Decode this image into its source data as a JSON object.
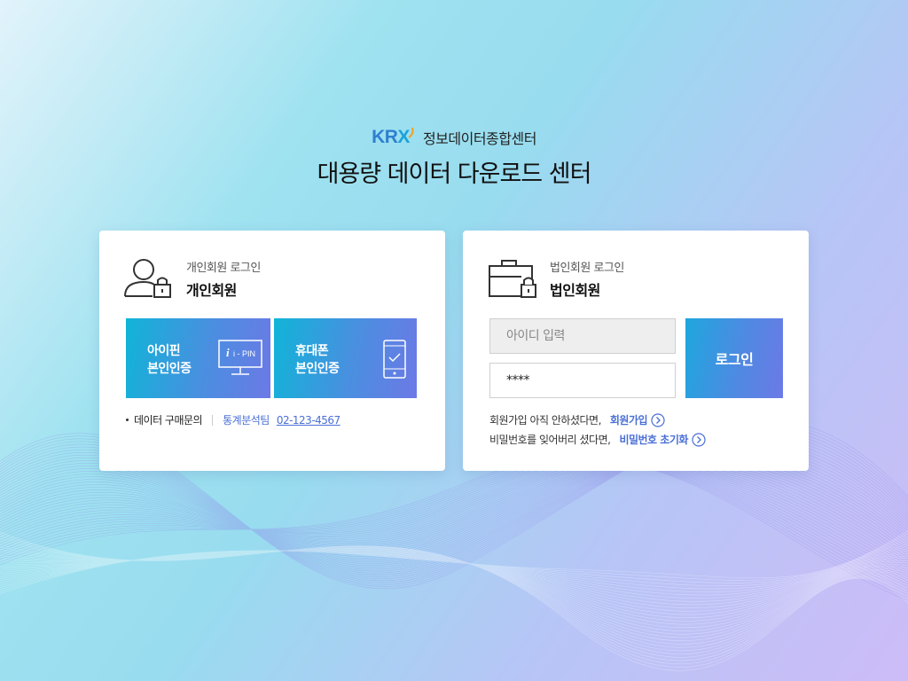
{
  "brand": {
    "logo_text": "KRX",
    "subtitle": "정보데이터종합센터",
    "title": "대용량 데이터 다운로드 센터"
  },
  "personal": {
    "sub": "개인회원 로그인",
    "name": "개인회원",
    "icon": "person-lock-icon",
    "ipin_line1": "아이핀",
    "ipin_line2": "본인인증",
    "ipin_icon": "ipin-monitor-icon",
    "ipin_icon_text": "i - PIN",
    "phone_line1": "휴대폰",
    "phone_line2": "본인인증",
    "phone_icon": "smartphone-check-icon",
    "inquiry_label": "데이터 구매문의",
    "inquiry_team": "통계분석팀",
    "inquiry_tel": "02-123-4567"
  },
  "corporate": {
    "sub": "법인회원 로그인",
    "name": "법인회원",
    "icon": "briefcase-lock-icon",
    "id_placeholder": "아이디 입력",
    "pw_value": "****",
    "login_label": "로그인",
    "signup_text": "회원가입 아직 안하셨다면,",
    "signup_link": "회원가입",
    "reset_text": "비밀번호를 잊어버리 셨다면,",
    "reset_link": "비밀번호 초기화"
  },
  "colors": {
    "accent": "#4a6fd6",
    "button_start": "#10b4d8",
    "button_end": "#6c79e6",
    "krx_blue": "#2f7fd0"
  }
}
